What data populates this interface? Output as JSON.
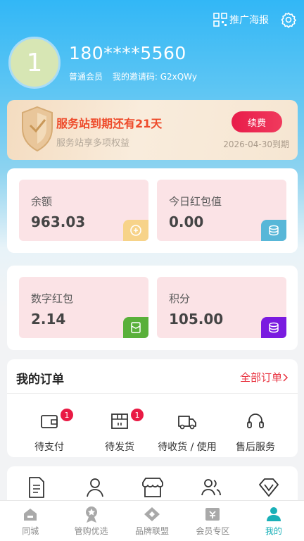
{
  "header": {
    "poster_label": "推广海报",
    "settings_icon": "gear-icon"
  },
  "profile": {
    "avatar_text": "1",
    "phone": "180****5560",
    "member_level": "普通会员",
    "invite_code": "我的邀请码: G2xQWy"
  },
  "station": {
    "title": "服务站到期还有21天",
    "subtitle": "服务站享多项权益",
    "renew_label": "续费",
    "expire_text": "2026-04-30到期"
  },
  "wallet": [
    {
      "label": "余额",
      "value": "963.03",
      "icon": "wallet-icon",
      "icon_color": "#f7d389"
    },
    {
      "label": "今日红包值",
      "value": "0.00",
      "icon": "coins-icon",
      "icon_color": "#58b7d8"
    },
    {
      "label": "数字红包",
      "value": "2.14",
      "icon": "redpacket-icon",
      "icon_color": "#59b03a"
    },
    {
      "label": "积分",
      "value": "105.00",
      "icon": "points-icon",
      "icon_color": "#7a1be0"
    }
  ],
  "orders": {
    "title": "我的订单",
    "all_label": "全部订单",
    "items": [
      {
        "label": "待支付",
        "badge": "1",
        "icon": "wallet-outline-icon"
      },
      {
        "label": "待发货",
        "badge": "1",
        "icon": "package-icon"
      },
      {
        "label": "待收货 / 使用",
        "badge": "",
        "icon": "truck-icon"
      },
      {
        "label": "售后服务",
        "badge": "",
        "icon": "headset-icon"
      }
    ]
  },
  "services": [
    "document-icon",
    "user-icon",
    "store-icon",
    "team-icon",
    "vip-icon"
  ],
  "tabs": [
    {
      "label": "同城",
      "icon": "home-icon",
      "active": false
    },
    {
      "label": "管购优选",
      "icon": "award-icon",
      "active": false
    },
    {
      "label": "品牌联盟",
      "icon": "diamond-icon",
      "active": false
    },
    {
      "label": "会员专区",
      "icon": "ticket-icon",
      "active": false
    },
    {
      "label": "我的",
      "icon": "person-icon",
      "active": true
    }
  ],
  "colors": {
    "primary": "#32b7f6",
    "accent_red": "#e8323f",
    "active_tab": "#1ab0b8"
  }
}
